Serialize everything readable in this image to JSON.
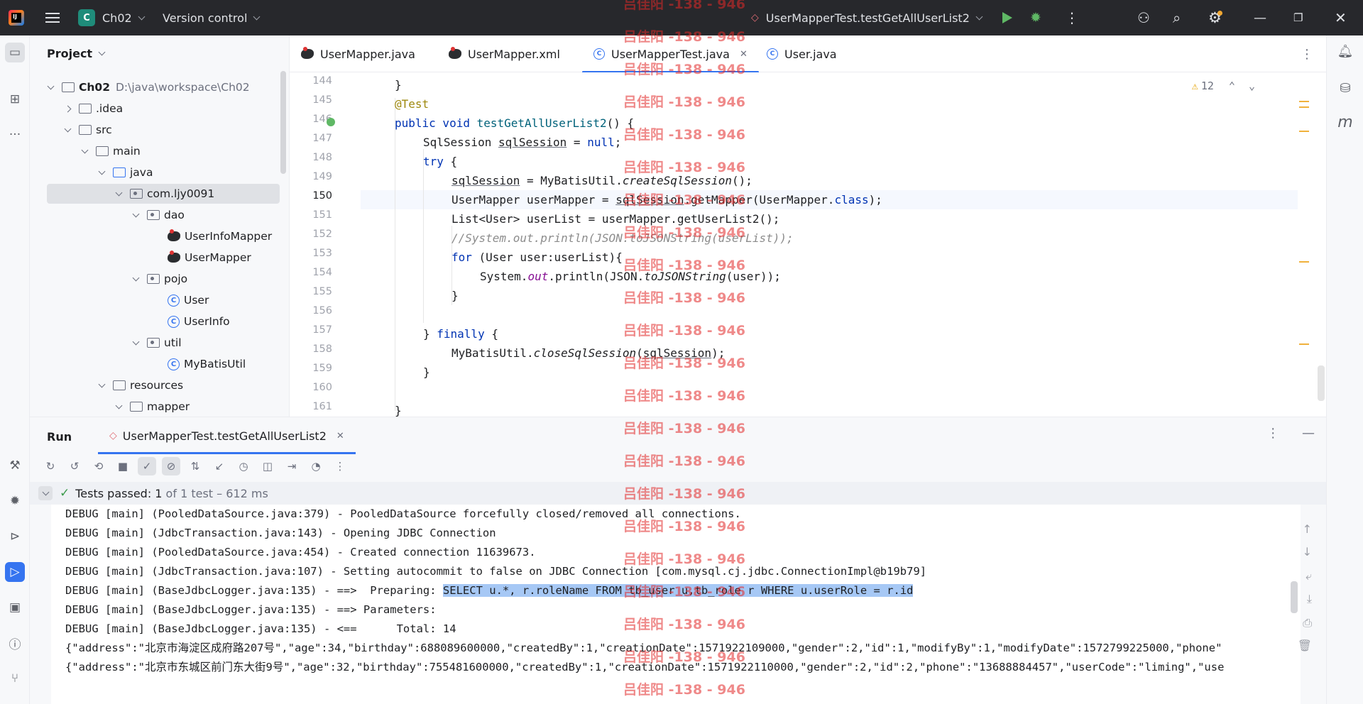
{
  "titlebar": {
    "project_initial": "C",
    "project_name": "Ch02",
    "vcs": "Version control",
    "run_config": "UserMapperTest.testGetAllUserList2"
  },
  "project_panel": {
    "title": "Project",
    "tree": [
      {
        "label": "Ch02",
        "path": "D:\\java\\workspace\\Ch02"
      },
      {
        "label": ".idea"
      },
      {
        "label": "src"
      },
      {
        "label": "main"
      },
      {
        "label": "java"
      },
      {
        "label": "com.ljy0091"
      },
      {
        "label": "dao"
      },
      {
        "label": "UserInfoMapper"
      },
      {
        "label": "UserMapper"
      },
      {
        "label": "pojo"
      },
      {
        "label": "User"
      },
      {
        "label": "UserInfo"
      },
      {
        "label": "util"
      },
      {
        "label": "MyBatisUtil"
      },
      {
        "label": "resources"
      },
      {
        "label": "mapper"
      }
    ]
  },
  "tabs": [
    {
      "label": "UserMapper.java"
    },
    {
      "label": "UserMapper.xml"
    },
    {
      "label": "UserMapperTest.java"
    },
    {
      "label": "User.java"
    }
  ],
  "editor": {
    "warning_count": "12",
    "line_numbers": [
      "144",
      "145",
      "146",
      "147",
      "148",
      "149",
      "150",
      "151",
      "152",
      "153",
      "154",
      "155",
      "156",
      "157",
      "158",
      "159",
      "160",
      "161"
    ]
  },
  "run_panel": {
    "title": "Run",
    "tab_label": "UserMapperTest.testGetAllUserList2",
    "status_passed": "Tests passed: 1",
    "status_rest": " of 1 test – 612 ms",
    "console": [
      "DEBUG [main] (PooledDataSource.java:379) - PooledDataSource forcefully closed/removed all connections.",
      "DEBUG [main] (JdbcTransaction.java:143) - Opening JDBC Connection",
      "DEBUG [main] (PooledDataSource.java:454) - Created connection 11639673.",
      "DEBUG [main] (JdbcTransaction.java:107) - Setting autocommit to false on JDBC Connection [com.mysql.cj.jdbc.ConnectionImpl@b19b79]",
      "DEBUG [main] (BaseJdbcLogger.java:135) - ==>  Preparing: ",
      "DEBUG [main] (BaseJdbcLogger.java:135) - ==> Parameters: ",
      "DEBUG [main] (BaseJdbcLogger.java:135) - <==      Total: 14",
      "{\"address\":\"北京市海淀区成府路207号\",\"age\":34,\"birthday\":688089600000,\"createdBy\":1,\"creationDate\":1571922109000,\"gender\":2,\"id\":1,\"modifyBy\":1,\"modifyDate\":1572799225000,\"phone\"",
      "{\"address\":\"北京市东城区前门东大街9号\",\"age\":32,\"birthday\":755481600000,\"createdBy\":1,\"creationDate\":1571922110000,\"gender\":2,\"id\":2,\"phone\":\"13688884457\",\"userCode\":\"liming\",\"use"
    ],
    "sql_highlight": "SELECT u.*, r.roleName FROM tb_user u,tb_role r WHERE u.userRole = r.id"
  },
  "watermark": "吕佳阳 -138 - 946",
  "colors": {
    "accent": "#3574f0",
    "keyword": "#0033b3",
    "annotation": "#9e880d",
    "pass": "#3b9a4b"
  }
}
